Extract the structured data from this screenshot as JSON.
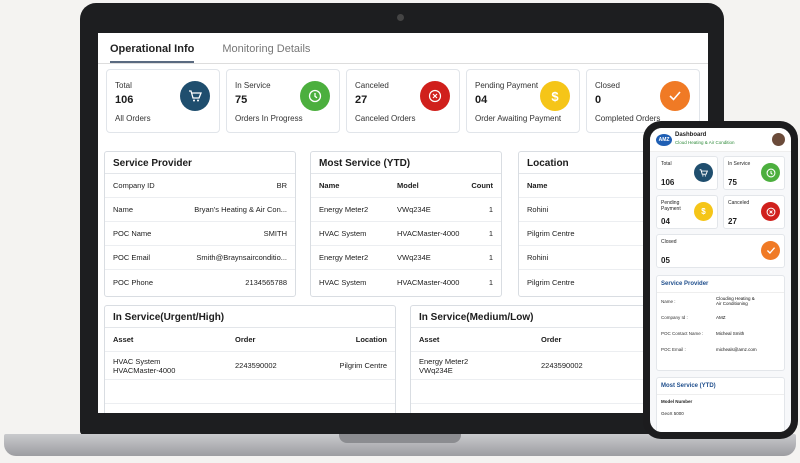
{
  "laptop": {
    "tabs": [
      {
        "label": "Operational Info",
        "active": true
      },
      {
        "label": "Monitoring Details",
        "active": false
      }
    ],
    "stats": [
      {
        "label": "Total",
        "value": "106",
        "sub": "All Orders",
        "icon": "cart-icon",
        "color": "#1f4e6e"
      },
      {
        "label": "In Service",
        "value": "75",
        "sub": "Orders In Progress",
        "icon": "clock-icon",
        "color": "#4caf3e"
      },
      {
        "label": "Canceled",
        "value": "27",
        "sub": "Canceled Orders",
        "icon": "cancel-icon",
        "color": "#d0201c"
      },
      {
        "label": "Pending Payment",
        "value": "04",
        "sub": "Order Awaiting Payment",
        "icon": "dollar-icon",
        "color": "#f5c518"
      },
      {
        "label": "Closed",
        "value": "0",
        "sub": "Completed Orders",
        "icon": "check-icon",
        "color": "#f07a25"
      }
    ],
    "service_provider": {
      "title": "Service Provider",
      "rows": [
        {
          "key": "Company ID",
          "value": "BR"
        },
        {
          "key": "Name",
          "value": "Bryan's Heating & Air Con..."
        },
        {
          "key": "POC Name",
          "value": "SMITH"
        },
        {
          "key": "POC Email",
          "value": "Smith@Braynsairconditio..."
        },
        {
          "key": "POC Phone",
          "value": "2134565788"
        }
      ]
    },
    "most_service": {
      "title": "Most Service (YTD)",
      "columns": [
        "Name",
        "Model",
        "Count"
      ],
      "rows": [
        [
          "Energy Meter2",
          "VWq234E",
          "1"
        ],
        [
          "HVAC System",
          "HVACMaster-4000",
          "1"
        ],
        [
          "Energy Meter2",
          "VWq234E",
          "1"
        ],
        [
          "HVAC System",
          "HVACMaster-4000",
          "1"
        ]
      ]
    },
    "location": {
      "title": "Location",
      "column": "Name",
      "rows": [
        "Rohini",
        "Pilgrim Centre",
        "Rohini",
        "Pilgrim Centre"
      ]
    },
    "urgent": {
      "title": "In Service(Urgent/High)",
      "columns": [
        "Asset",
        "Order",
        "Location"
      ],
      "rows": [
        [
          "HVAC System\nHVACMaster-4000",
          "2243590002",
          "Pilgrim Centre"
        ]
      ]
    },
    "medium": {
      "title": "In Service(Medium/Low)",
      "columns": [
        "Asset",
        "Order"
      ],
      "rows": [
        [
          "Energy Meter2\nVWq234E",
          "2243590002"
        ]
      ]
    }
  },
  "phone": {
    "logo": "AMZ",
    "title": "Dashboard",
    "subtitle": "Cloud Heating & Air Condition",
    "cards": [
      {
        "label": "Total",
        "value": "106",
        "icon": "cart-icon",
        "color": "#1f4e6e"
      },
      {
        "label": "In Service",
        "value": "75",
        "icon": "clock-icon",
        "color": "#4caf3e"
      },
      {
        "label": "Pending\nPayment",
        "value": "04",
        "icon": "dollar-icon",
        "color": "#f5c518"
      },
      {
        "label": "Canceled",
        "value": "27",
        "icon": "cancel-icon",
        "color": "#d0201c"
      },
      {
        "label": "Closed",
        "value": "05",
        "icon": "check-icon",
        "color": "#f07a25"
      }
    ],
    "service_provider": {
      "title": "Service Provider",
      "rows": [
        {
          "key": "Name :",
          "value": "Clouding Heating &\nAir Conditioning"
        },
        {
          "key": "Company Id :",
          "value": "AMZ"
        },
        {
          "key": "POC Contact Name :",
          "value": "Micheal Smith"
        },
        {
          "key": "POC Email :",
          "value": "micheals@amz.com"
        }
      ]
    },
    "most_service": {
      "title": "Most Service (YTD)",
      "label": "Model Number",
      "value": "GeoX 5000"
    }
  }
}
